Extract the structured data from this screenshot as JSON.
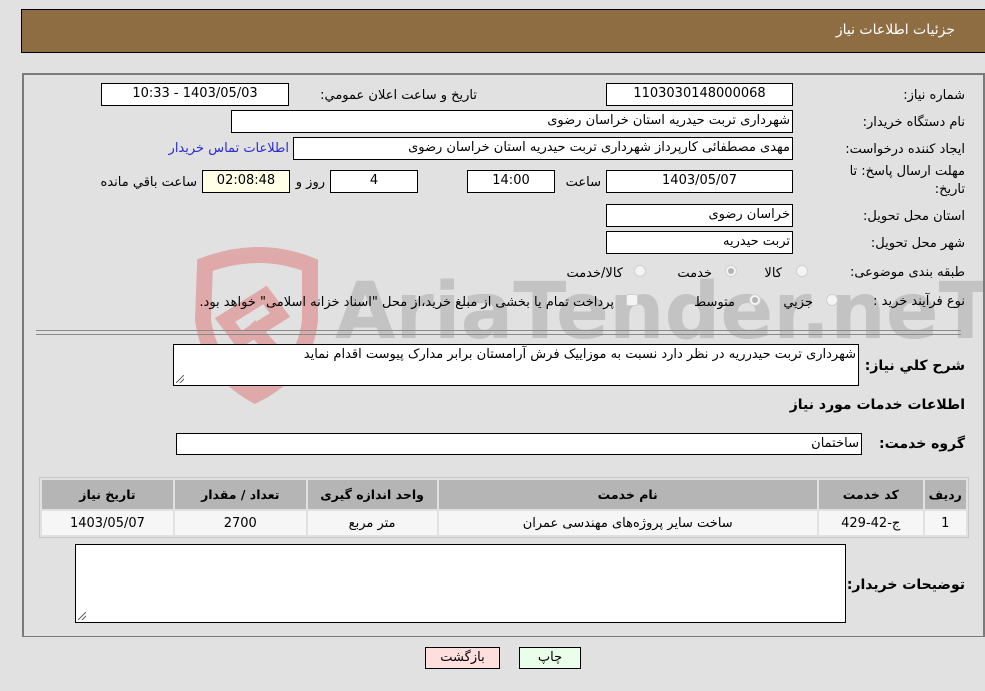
{
  "header": {
    "title": "جزئیات اطلاعات نیاز"
  },
  "form": {
    "need_number": {
      "label": "شماره نیاز:",
      "value": "1103030148000068"
    },
    "announce_datetime": {
      "label": "تاریخ و ساعت اعلان عمومي:",
      "value": "1403/05/03 - 10:33"
    },
    "buyer_org": {
      "label": "نام دستگاه خریدار:",
      "value": "شهرداری تربت حیدریه استان خراسان رضوی"
    },
    "requester": {
      "label": "ایجاد کننده درخواست:",
      "value": "مهدی مصطفائی کارپرداز شهرداری تربت حیدریه استان خراسان رضوی"
    },
    "buyer_contact_link": "اطلاعات تماس خریدار",
    "deadline": {
      "label_line1": "مهلت ارسال پاسخ: تا",
      "label_line2": "تاریخ:",
      "date": "1403/05/07",
      "time_label": "ساعت",
      "time": "14:00",
      "days": "4",
      "days_label": "روز و",
      "remaining": "02:08:48",
      "remaining_label": "ساعت باقي مانده"
    },
    "delivery_province": {
      "label": "استان محل تحویل:",
      "value": "خراسان رضوی"
    },
    "delivery_city": {
      "label": "شهر محل تحویل:",
      "value": "تربت حیدریه"
    },
    "category": {
      "label": "طبقه بندی موضوعی:",
      "options": [
        "کالا",
        "خدمت",
        "کالا/خدمت"
      ],
      "selected": "خدمت"
    },
    "purchase_type": {
      "label": "نوع فرآیند خرید :",
      "options": [
        "جزيي",
        "متوسط"
      ],
      "selected": "متوسط",
      "treasury_note": "پرداخت تمام یا بخشی از مبلغ خرید،از محل \"اسناد خزانه اسلامی\" خواهد بود.",
      "treasury_checked": false
    }
  },
  "description": {
    "label": "شرح کلي نیاز:",
    "value": "شهرداری تربت حیدرریه در نظر دارد نسبت به موزاییک فرش  آرامستان برابر مدارک پیوست اقدام نماید"
  },
  "services_section": {
    "title": "اطلاعات خدمات مورد نیاز",
    "group_label": "گروه خدمت:",
    "group_value": "ساختمان"
  },
  "table": {
    "headers": [
      "ردیف",
      "کد خدمت",
      "نام خدمت",
      "واحد اندازه گیری",
      "تعداد / مقدار",
      "تاریخ نیاز"
    ],
    "rows": [
      [
        "1",
        "ج-42-429",
        "ساخت سایر پروژه‌های مهندسی عمران",
        "متر مربع",
        "2700",
        "1403/05/07"
      ]
    ]
  },
  "buyer_notes": {
    "label": "توضیحات خریدار:",
    "value": ""
  },
  "buttons": {
    "print": "چاپ",
    "back": "بازگشت"
  },
  "watermark": {
    "text": "AriaTender.neT"
  },
  "colors": {
    "header_bg": "#8f6d42",
    "link": "#2a2ad6",
    "print_bg": "#eaffea",
    "back_bg": "#ffdede"
  }
}
